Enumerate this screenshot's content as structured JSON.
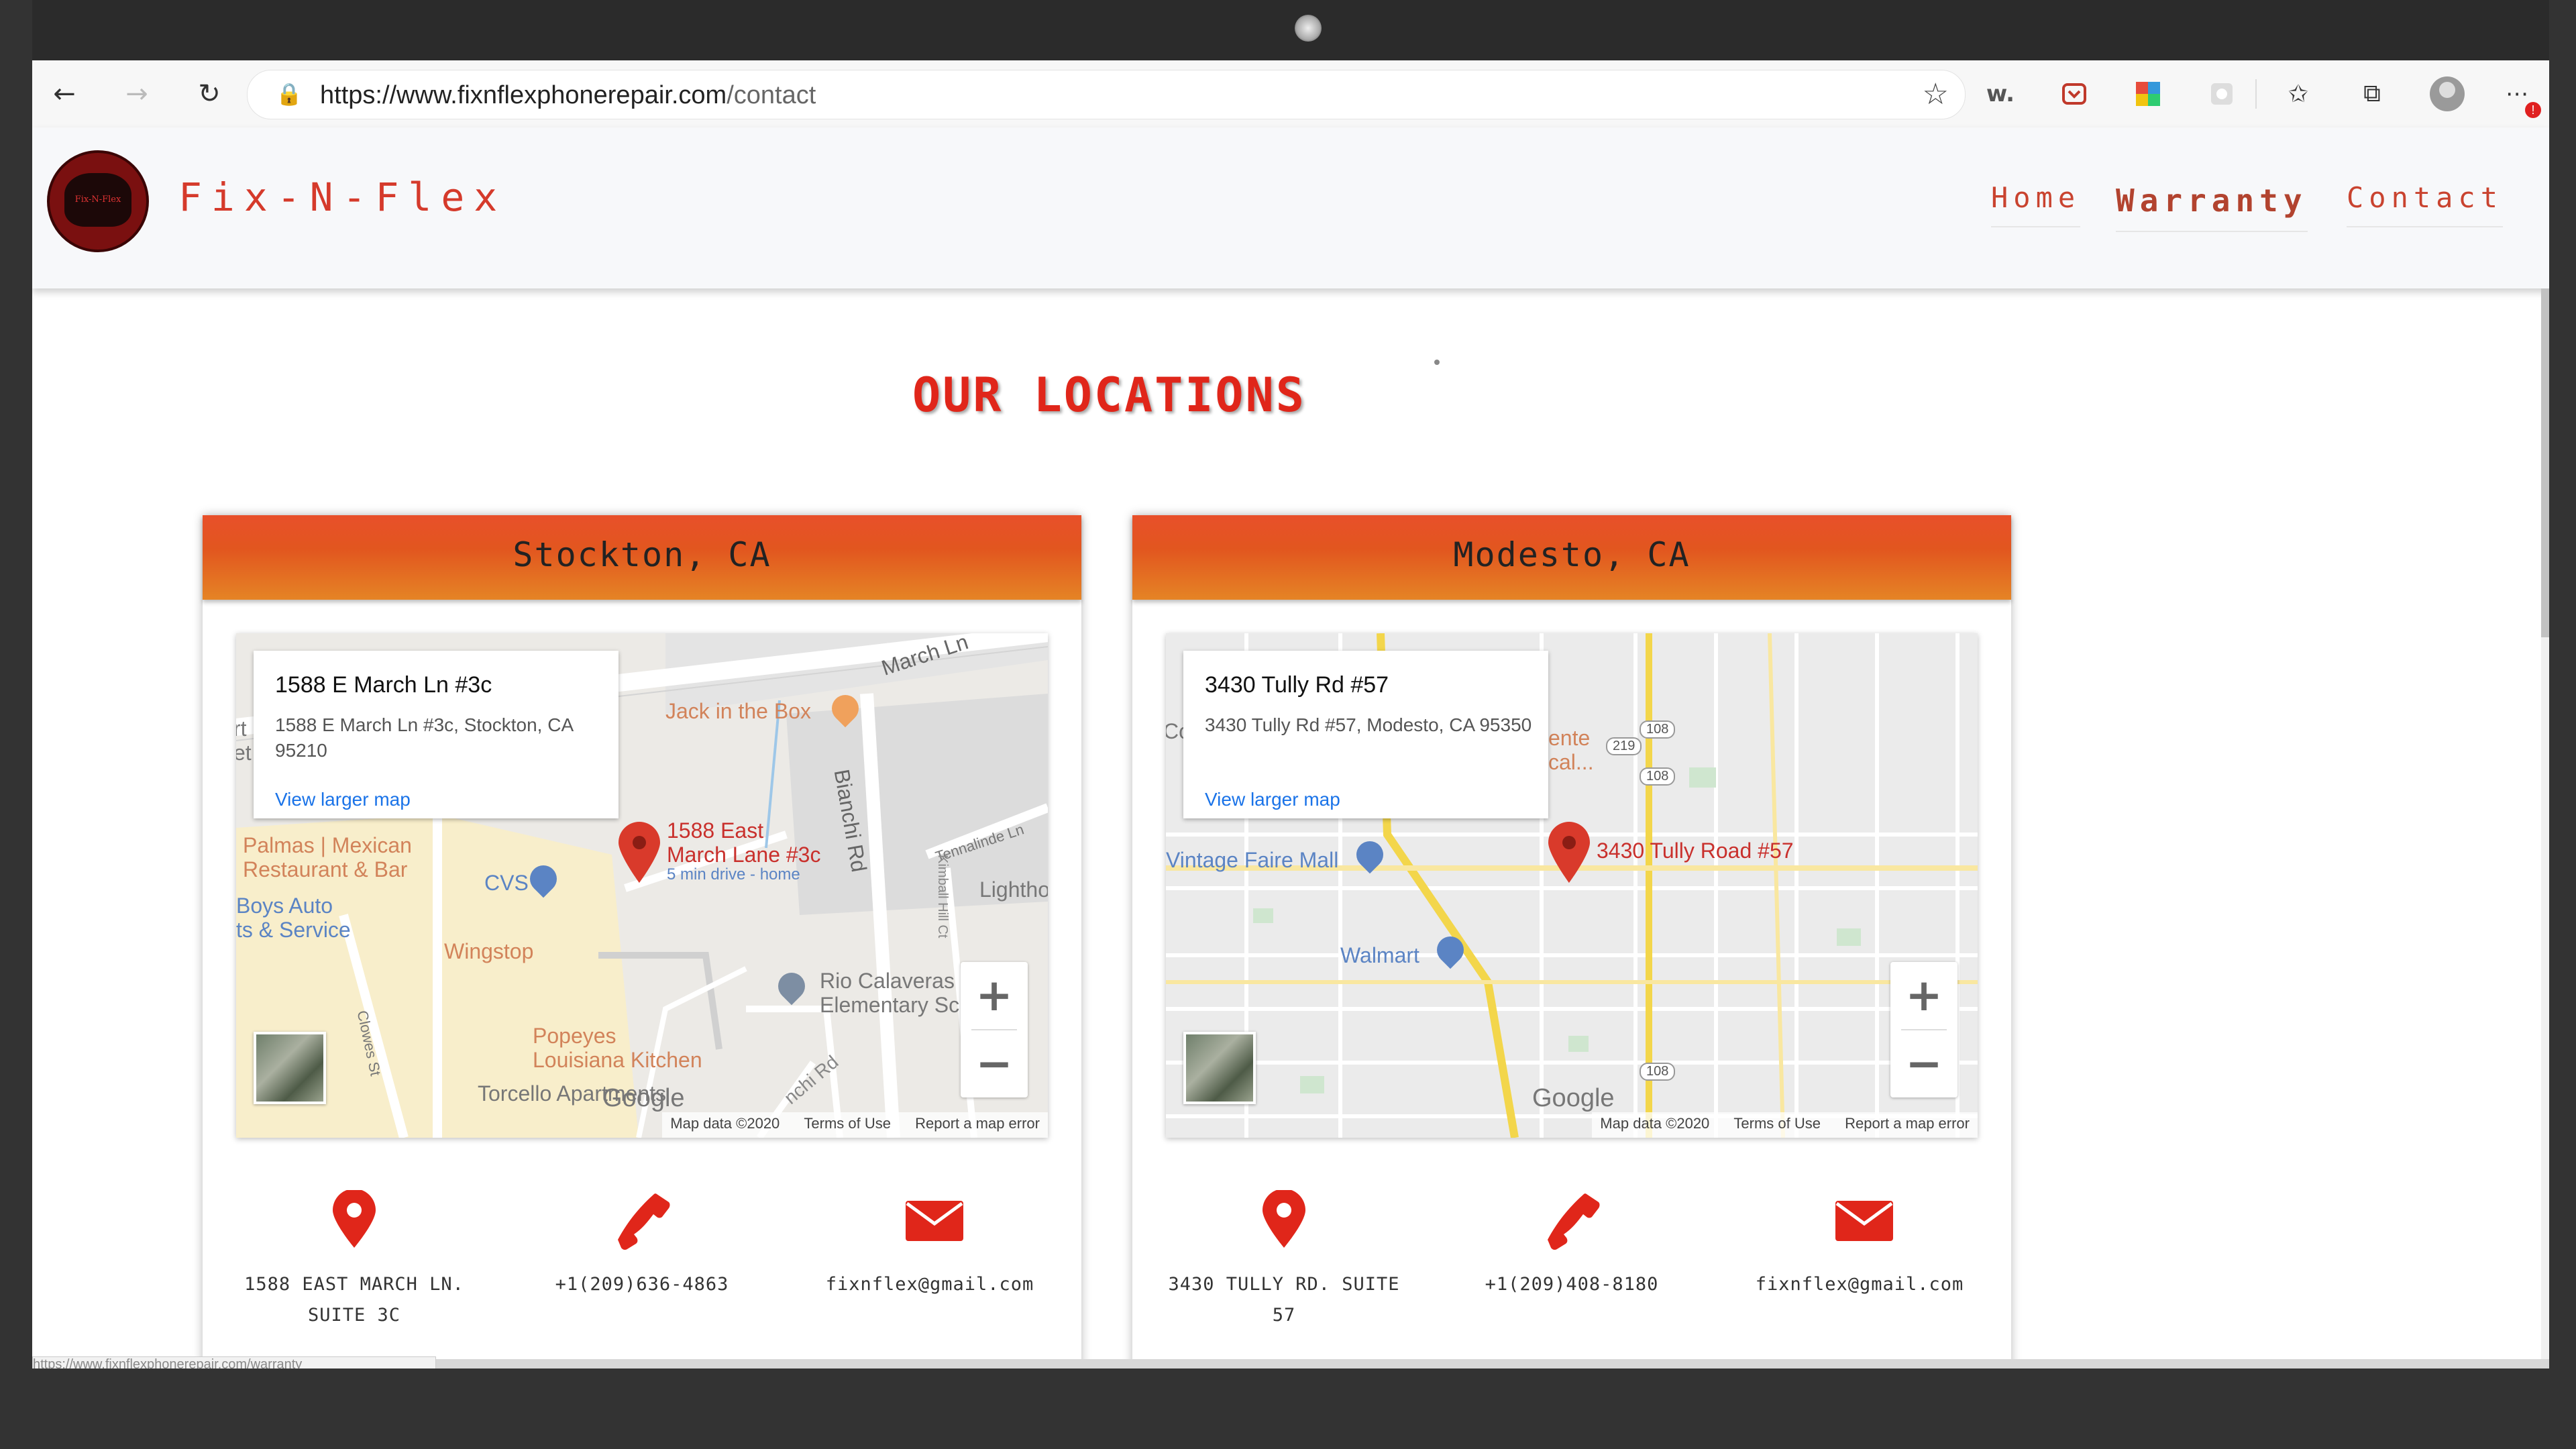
{
  "browser": {
    "url_host": "https://www.fixnflexphonerepair.com",
    "url_path": "/contact",
    "status_url": "https://www.fixnflexphonerepair.com/warranty",
    "extension_label": "w."
  },
  "site": {
    "brand": "Fix-N-Flex",
    "logo_text": "Fix-N-Flex",
    "nav": {
      "home": "Home",
      "warranty": "Warranty",
      "contact": "Contact"
    }
  },
  "page": {
    "title": "OUR LOCATIONS"
  },
  "colors": {
    "accent": "#e0261a",
    "header_gradient_start": "#e8502a",
    "header_gradient_end": "#e58425",
    "brand": "#d53a2b"
  },
  "locations": [
    {
      "city": "Stockton, CA",
      "map": {
        "info_title": "1588 E March Ln #3c",
        "info_address": "1588 E March Ln #3c, Stockton, CA 95210",
        "view_larger": "View larger map",
        "pin_label_line1": "1588 East",
        "pin_label_line2": "March Lane #3c",
        "pin_sublabel": "5 min drive - home",
        "labels": {
          "march_ln": "March Ln",
          "jack": "Jack in the Box",
          "bianchi": "Bianchi Rd",
          "tennalinde": "Tennalinde Ln",
          "palmas1": "Palmas | Mexican",
          "palmas2": "Restaurant & Bar",
          "cvs": "CVS",
          "boys1": "Boys Auto",
          "boys2": "ts & Service",
          "wingstop": "Wingstop",
          "lighthouse": "Lightho",
          "kimball": "Kimball Hill Ct",
          "rio1": "Rio Calaveras",
          "rio2": "Elementary Sc",
          "clowes": "Clowes St",
          "popeyes1": "Popeyes",
          "popeyes2": "Louisiana Kitchen",
          "torcello": "Torcello Apartments",
          "nchi": "nchi Rd",
          "edge1": "rt",
          "edge2": "et"
        },
        "footer": {
          "data": "Map data ©2020",
          "terms": "Terms of Use",
          "report": "Report a map error"
        }
      },
      "address_line1": "1588 EAST MARCH LN.",
      "address_line2": "SUITE 3C",
      "phone": "+1(209)636-4863",
      "email": "fixnflex@gmail.com"
    },
    {
      "city": "Modesto, CA",
      "map": {
        "info_title": "3430 Tully Rd #57",
        "info_address": "3430 Tully Rd #57, Modesto, CA 95350",
        "view_larger": "View larger map",
        "pin_label_line1": "3430 Tully Road #57",
        "labels": {
          "vintage": "Vintage Faire Mall",
          "walmart": "Walmart",
          "ente1": "ente",
          "ente2": "cal...",
          "r108": "108",
          "r219": "219",
          "edge": "Co"
        },
        "footer": {
          "data": "Map data ©2020",
          "terms": "Terms of Use",
          "report": "Report a map error"
        }
      },
      "address_line1": "3430 TULLY RD. SUITE",
      "address_line2": "57",
      "phone": "+1(209)408-8180",
      "email": "fixnflex@gmail.com"
    }
  ],
  "map_brand": "Google"
}
